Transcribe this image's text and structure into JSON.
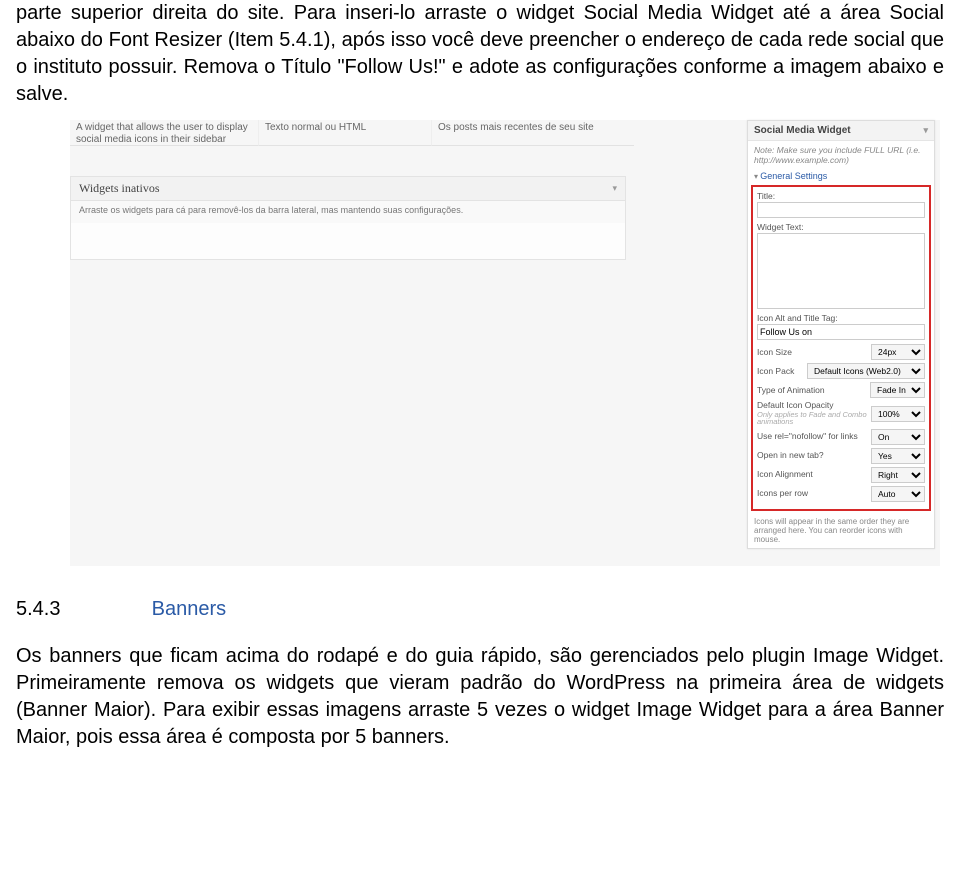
{
  "intro": {
    "p1": "parte superior direita do site. Para inseri-lo arraste o widget Social Media Widget até a área Social abaixo do Font Resizer (Item 5.4.1), após isso você deve preencher o endereço de cada rede social que o instituto possuir. Remova o Título \"Follow Us!\" e adote as configurações conforme a imagem abaixo e salve."
  },
  "screenshot": {
    "top_col1": "A widget that allows the user to display social media icons in their sidebar",
    "top_col2": "Texto normal ou HTML",
    "top_col3": "Os posts mais recentes de seu site",
    "inactive_title": "Widgets inativos",
    "inactive_desc": "Arraste os widgets para cá para removê-los da barra lateral, mas mantendo suas configurações."
  },
  "widget": {
    "title": "Social Media Widget",
    "note": "Note: Make sure you include FULL URL (i.e. http://www.example.com)",
    "general": "General Settings",
    "lbl_title": "Title:",
    "val_title": "",
    "lbl_widget_text": "Widget Text:",
    "val_widget_text": "",
    "lbl_icon_alt": "Icon Alt and Title Tag:",
    "val_icon_alt": "Follow Us on",
    "lbl_icon_size": "Icon Size",
    "val_icon_size": "24px",
    "lbl_icon_pack": "Icon Pack",
    "val_icon_pack": "Default Icons (Web2.0)",
    "lbl_anim": "Type of Animation",
    "val_anim": "Fade In",
    "lbl_opacity": "Default Icon Opacity",
    "hint_opacity": "Only applies to Fade and Combo animations",
    "val_opacity": "100%",
    "lbl_nofollow": "Use rel=\"nofollow\" for links",
    "val_nofollow": "On",
    "lbl_newtab": "Open in new tab?",
    "val_newtab": "Yes",
    "lbl_align": "Icon Alignment",
    "val_align": "Right",
    "lbl_perrow": "Icons per row",
    "val_perrow": "Auto",
    "footer_note": "Icons will appear in the same order they are arranged here. You can reorder icons with mouse."
  },
  "section": {
    "num": "5.4.3",
    "title": "Banners"
  },
  "outro": {
    "p1": "Os banners que ficam acima do rodapé e do guia rápido, são gerenciados pelo plugin Image Widget. Primeiramente remova os widgets que vieram padrão do WordPress na primeira área de widgets (Banner Maior). Para exibir essas imagens arraste 5 vezes o widget Image Widget para a área Banner Maior, pois essa área é composta por 5 banners."
  }
}
